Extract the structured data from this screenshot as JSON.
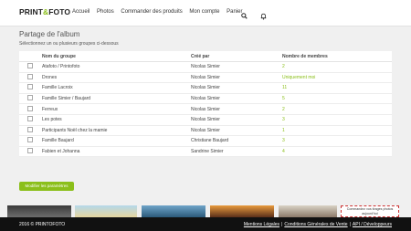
{
  "header": {
    "logo_left": "PRINT",
    "logo_mid": "&",
    "logo_right": "FOTO",
    "nav": [
      "Accueil",
      "Photos",
      "Commander des produits",
      "Mon compte",
      "Panier"
    ]
  },
  "page": {
    "title": "Partage de l'album",
    "subtitle": "Sélectionnez un ou plusieurs groupes ci-dessous"
  },
  "table": {
    "headers": [
      "Nom du groupe",
      "Créé par",
      "Nombre de membres"
    ],
    "rows": [
      {
        "name": "Atafoto / Printofoto",
        "creator": "Nicolas Simier",
        "members": "2"
      },
      {
        "name": "Drones",
        "creator": "Nicolas Simier",
        "members": "Uniquement moi"
      },
      {
        "name": "Famille Lacroix",
        "creator": "Nicolas Simier",
        "members": "11"
      },
      {
        "name": "Famille Simier / Baujard",
        "creator": "Nicolas Simier",
        "members": "5"
      },
      {
        "name": "Ferreux",
        "creator": "Nicolas Simier",
        "members": "2"
      },
      {
        "name": "Les potes",
        "creator": "Nicolas Simier",
        "members": "3"
      },
      {
        "name": "Participants Noël chez la mamie",
        "creator": "Nicolas Simier",
        "members": "1"
      },
      {
        "name": "Famille Baujard",
        "creator": "Christiane Baujard",
        "members": "3"
      },
      {
        "name": "Fabien et Johanna",
        "creator": "Sandrine Simier",
        "members": "4"
      }
    ]
  },
  "actions": {
    "modify_label": "Modifier les paramètres"
  },
  "tooltip": {
    "line1": "Commandez vos tirages photos",
    "line2": "aujourd'hui"
  },
  "footer": {
    "copyright": "2016 © PRINTOFOTO",
    "link1": "Mentions Légales",
    "link2": "Conditions Générales de Vente",
    "link3": "API / Développeurs"
  },
  "colors": {
    "accent": "#8bbf1a",
    "footer_bg": "#111111"
  },
  "icons": [
    "search-icon",
    "bell-icon",
    "checkbox-icon"
  ]
}
